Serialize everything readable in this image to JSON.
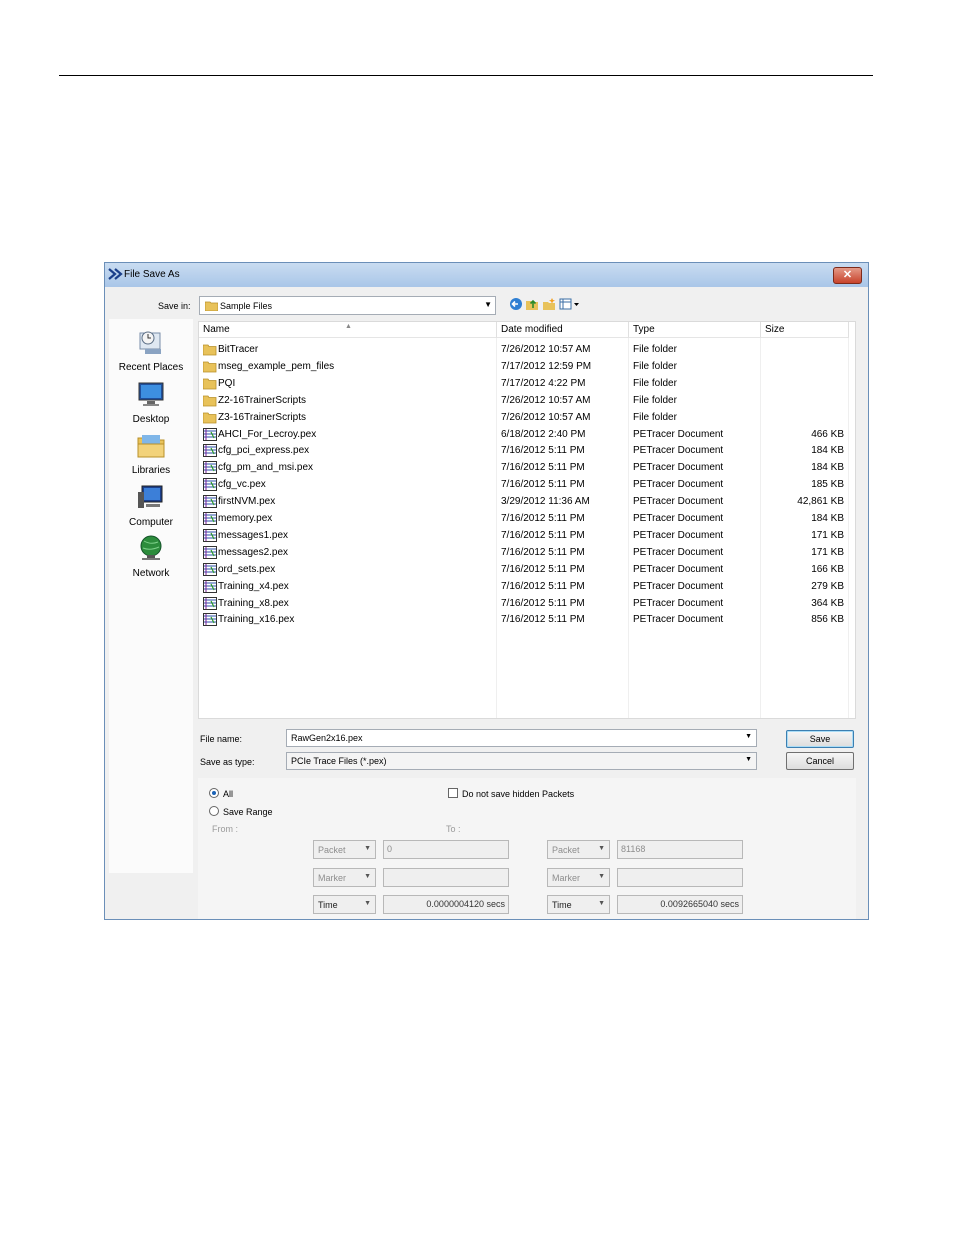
{
  "dialog": {
    "title": "File Save As",
    "close_glyph": "✕"
  },
  "toolbar": {
    "save_in_label": "Save in:",
    "save_in_value": "Sample Files",
    "icons": [
      "back-arrow-icon",
      "up-folder-icon",
      "new-folder-icon",
      "view-menu-icon"
    ]
  },
  "places": [
    "Recent Places",
    "Desktop",
    "Libraries",
    "Computer",
    "Network"
  ],
  "columns": {
    "name": "Name",
    "date": "Date modified",
    "type": "Type",
    "size": "Size"
  },
  "files": [
    {
      "name": "BitTracer",
      "date": "7/26/2012 10:57 AM",
      "type": "File folder",
      "size": "",
      "kind": "folder"
    },
    {
      "name": "mseg_example_pem_files",
      "date": "7/17/2012 12:59 PM",
      "type": "File folder",
      "size": "",
      "kind": "folder"
    },
    {
      "name": "PQI",
      "date": "7/17/2012 4:22 PM",
      "type": "File folder",
      "size": "",
      "kind": "folder"
    },
    {
      "name": "Z2-16TrainerScripts",
      "date": "7/26/2012 10:57 AM",
      "type": "File folder",
      "size": "",
      "kind": "folder"
    },
    {
      "name": "Z3-16TrainerScripts",
      "date": "7/26/2012 10:57 AM",
      "type": "File folder",
      "size": "",
      "kind": "folder"
    },
    {
      "name": "AHCI_For_Lecroy.pex",
      "date": "6/18/2012 2:40 PM",
      "type": "PETracer Document",
      "size": "466 KB",
      "kind": "doc"
    },
    {
      "name": "cfg_pci_express.pex",
      "date": "7/16/2012 5:11 PM",
      "type": "PETracer Document",
      "size": "184 KB",
      "kind": "doc"
    },
    {
      "name": "cfg_pm_and_msi.pex",
      "date": "7/16/2012 5:11 PM",
      "type": "PETracer Document",
      "size": "184 KB",
      "kind": "doc"
    },
    {
      "name": "cfg_vc.pex",
      "date": "7/16/2012 5:11 PM",
      "type": "PETracer Document",
      "size": "185 KB",
      "kind": "doc"
    },
    {
      "name": "firstNVM.pex",
      "date": "3/29/2012 11:36 AM",
      "type": "PETracer Document",
      "size": "42,861 KB",
      "kind": "doc"
    },
    {
      "name": "memory.pex",
      "date": "7/16/2012 5:11 PM",
      "type": "PETracer Document",
      "size": "184 KB",
      "kind": "doc"
    },
    {
      "name": "messages1.pex",
      "date": "7/16/2012 5:11 PM",
      "type": "PETracer Document",
      "size": "171 KB",
      "kind": "doc"
    },
    {
      "name": "messages2.pex",
      "date": "7/16/2012 5:11 PM",
      "type": "PETracer Document",
      "size": "171 KB",
      "kind": "doc"
    },
    {
      "name": "ord_sets.pex",
      "date": "7/16/2012 5:11 PM",
      "type": "PETracer Document",
      "size": "166 KB",
      "kind": "doc"
    },
    {
      "name": "Training_x4.pex",
      "date": "7/16/2012 5:11 PM",
      "type": "PETracer Document",
      "size": "279 KB",
      "kind": "doc"
    },
    {
      "name": "Training_x8.pex",
      "date": "7/16/2012 5:11 PM",
      "type": "PETracer Document",
      "size": "364 KB",
      "kind": "doc"
    },
    {
      "name": "Training_x16.pex",
      "date": "7/16/2012 5:11 PM",
      "type": "PETracer Document",
      "size": "856 KB",
      "kind": "doc"
    }
  ],
  "form": {
    "file_name_label": "File name:",
    "file_name_value": "RawGen2x16.pex",
    "save_type_label": "Save as type:",
    "save_type_value": "PCIe Trace Files (*.pex)",
    "save_button": "Save",
    "cancel_button": "Cancel"
  },
  "options": {
    "all_label": "All",
    "all_selected": true,
    "save_range_label": "Save Range",
    "hidden_packets_label": "Do not save hidden Packets",
    "hidden_packets_checked": false,
    "from_label": "From :",
    "to_label": "To :",
    "from": {
      "packet_unit": "Packet",
      "packet_value": "0",
      "marker_unit": "Marker",
      "marker_value": "",
      "time_unit": "Time",
      "time_value": "0.0000004120 secs"
    },
    "to": {
      "packet_unit": "Packet",
      "packet_value": "81168",
      "marker_unit": "Marker",
      "marker_value": "",
      "time_unit": "Time",
      "time_value": "0.0092665040 secs"
    }
  },
  "colors": {
    "titlebar": "#a9c6e8",
    "close": "#c8432b",
    "folder": "#e8c25a",
    "selected_radio": "#1b63b6"
  }
}
